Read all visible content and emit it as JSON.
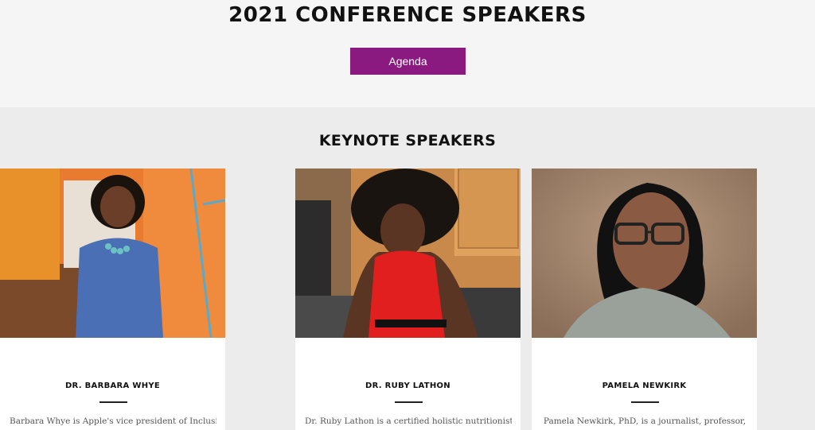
{
  "header": {
    "title": "2021 CONFERENCE SPEAKERS",
    "agenda_label": "Agenda"
  },
  "keynote": {
    "title": "KEYNOTE SPEAKERS",
    "speakers": [
      {
        "name": "DR. RUBY LATHON",
        "bio": "Dr. Ruby Lathon is a certified holistic nutritionist and"
      },
      {
        "name": "PAMELA NEWKIRK",
        "bio": "Pamela Newkirk, PhD, is a journalist, professor,"
      },
      {
        "name": "DR. BARBARA WHYE",
        "bio": "Barbara Whye is Apple's vice president of Inclusion &"
      }
    ]
  },
  "colors": {
    "accent": "#8b1a80",
    "top_band": "#f5f5f5",
    "body_bg": "#ececec"
  }
}
